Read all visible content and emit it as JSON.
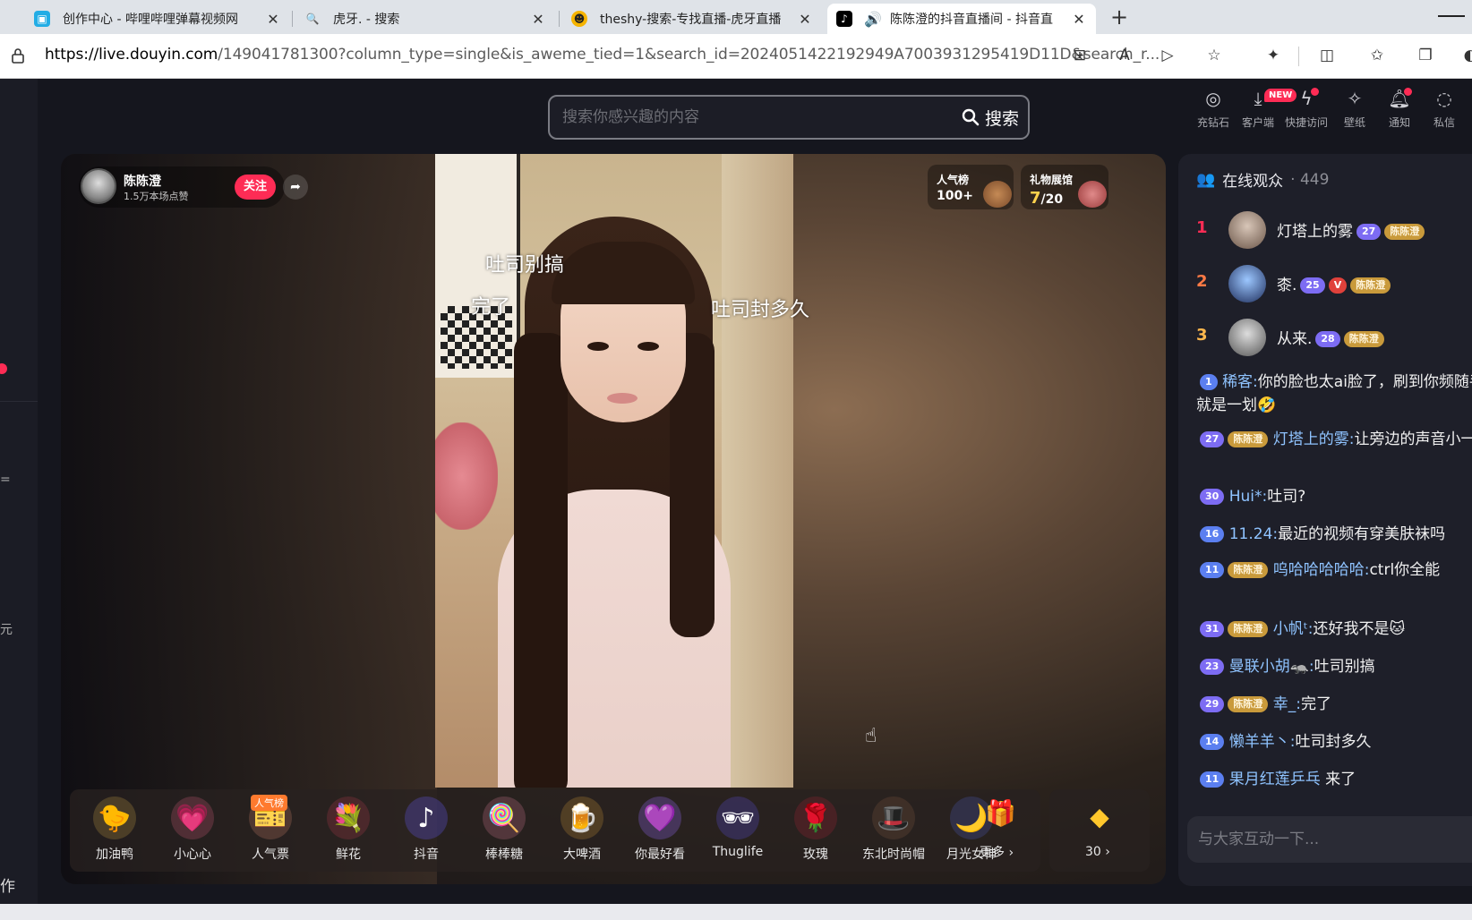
{
  "browser": {
    "tabs": [
      {
        "label": "创作中心 - 哔哩哔哩弹幕视频网",
        "icon": "bilibili-icon"
      },
      {
        "label": "虎牙. - 搜索",
        "icon": "search-icon"
      },
      {
        "label": "theshy-搜索-专找直播-虎牙直播",
        "icon": "huya-icon"
      },
      {
        "label": "陈陈澄的抖音直播间 - 抖音直",
        "icon": "douyin-icon"
      }
    ],
    "url_host": "https://live.douyin.com",
    "url_rest": "/149041781300?column_type=single&is_aweme_tied=1&search_id=2024051422192949A7003931295419D11D&search_r..."
  },
  "header": {
    "search_placeholder": "搜索你感兴趣的内容",
    "search_button": "搜索",
    "new_badge": "NEW",
    "nav": [
      {
        "label": "充钻石",
        "icon": "diamond-icon"
      },
      {
        "label": "客户端",
        "icon": "download-icon"
      },
      {
        "label": "快捷访问",
        "icon": "lightning-icon"
      },
      {
        "label": "壁纸",
        "icon": "wallpaper-icon"
      },
      {
        "label": "通知",
        "icon": "bell-icon"
      },
      {
        "label": "私信",
        "icon": "message-icon"
      }
    ]
  },
  "leftnav": {
    "bottom_text": "作"
  },
  "anchor": {
    "name": "陈陈澄",
    "likes": "1.5万本场点赞",
    "follow": "关注"
  },
  "rank": {
    "popularity_title": "人气榜",
    "popularity_value": "100+",
    "gift_hall_title": "礼物展馆",
    "gift_hall_current": "7",
    "gift_hall_total": "/20"
  },
  "danmu": [
    "吐司别搞",
    "完了",
    "吐司封多久"
  ],
  "gifts": [
    {
      "label": "加油鸭",
      "glyph": "🐤",
      "bg": "#f2c14e"
    },
    {
      "label": "小心心",
      "glyph": "💗",
      "bg": "#ff6f91"
    },
    {
      "label": "人气票",
      "glyph": "🎫",
      "bg": "#f39a7b",
      "tag": "人气榜"
    },
    {
      "label": "鲜花",
      "glyph": "💐",
      "bg": "#d9435a"
    },
    {
      "label": "抖音",
      "glyph": "♪",
      "bg": "#6a5cff"
    },
    {
      "label": "棒棒糖",
      "glyph": "🍭",
      "bg": "#ff8fb1"
    },
    {
      "label": "大啤酒",
      "glyph": "🍺",
      "bg": "#f5b53a"
    },
    {
      "label": "你最好看",
      "glyph": "💜",
      "bg": "#9a6cff"
    },
    {
      "label": "Thuglife",
      "glyph": "🕶",
      "bg": "#5b4fd9"
    },
    {
      "label": "玫瑰",
      "glyph": "🌹",
      "bg": "#c9243a"
    },
    {
      "label": "东北时尚帽",
      "glyph": "🎩",
      "bg": "#6b4a3a"
    },
    {
      "label": "月光女神",
      "glyph": "🌙",
      "bg": "#3b3e6b"
    }
  ],
  "more_gift": "更多 ›",
  "coin": {
    "value": "30 ›"
  },
  "audience": {
    "title": "在线观众",
    "count": "· 449",
    "top": [
      {
        "rank": "1",
        "name": "灯塔上的雾",
        "level": "27",
        "fan": "陈陈澄"
      },
      {
        "rank": "2",
        "name": "桼.",
        "level": "25",
        "vip": "V",
        "fan": "陈陈澄"
      },
      {
        "rank": "3",
        "name": "从来.",
        "level": "28",
        "fan": "陈陈澄"
      }
    ]
  },
  "chat": [
    {
      "level": "1",
      "user": "稀客:",
      "text": "你的脸也太ai脸了，刷到你频随手就是一划🤣"
    },
    {
      "level": "27",
      "fan": "陈陈澄",
      "user": "灯塔上的雾:",
      "text": "让旁边的声音小一点"
    },
    {
      "level": "30",
      "user": "Hui*:",
      "text": "吐司?"
    },
    {
      "level": "16",
      "user": "11.24:",
      "text": "最近的视频有穿美肤袜吗"
    },
    {
      "level": "11",
      "fan": "陈陈澄",
      "user": "呜哈哈哈哈哈:",
      "text": "ctrl你全能"
    },
    {
      "level": "31",
      "fan": "陈陈澄",
      "user": "小帆ᵗ:",
      "text": "还好我不是🐱"
    },
    {
      "level": "23",
      "user": "曼联小胡🦡:",
      "text": "吐司别搞"
    },
    {
      "level": "29",
      "fan": "陈陈澄",
      "user": "幸_:",
      "text": "完了"
    },
    {
      "level": "14",
      "user": "懒羊羊丶:",
      "text": "吐司封多久"
    },
    {
      "level": "11",
      "user": "果月红莲乒乓",
      "text": "来了"
    }
  ],
  "chat_input_placeholder": "与大家互动一下..."
}
